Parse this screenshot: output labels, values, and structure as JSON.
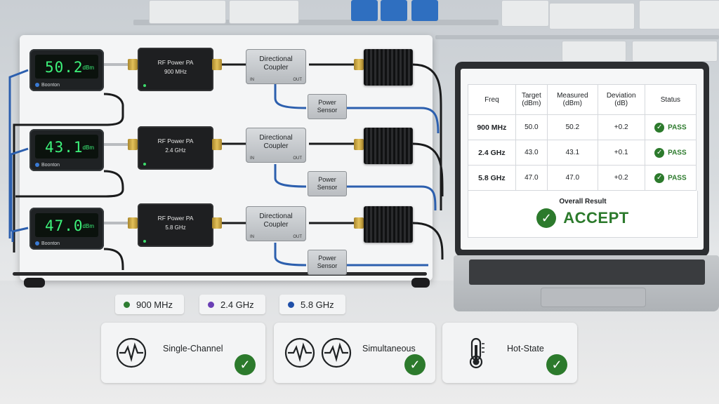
{
  "channels": [
    {
      "meter_value": "50.2",
      "meter_unit": "dBm",
      "meter_brand": "Boonton",
      "amp_title": "RF Power PA",
      "amp_freq": "900 MHz",
      "coupler": [
        "Directional",
        "Coupler"
      ],
      "sensor": [
        "Power",
        "Sensor"
      ]
    },
    {
      "meter_value": "43.1",
      "meter_unit": "dBm",
      "meter_brand": "Boonton",
      "amp_title": "RF Power PA",
      "amp_freq": "2.4 GHz",
      "coupler": [
        "Directional",
        "Coupler"
      ],
      "sensor": [
        "Power",
        "Sensor"
      ]
    },
    {
      "meter_value": "47.0",
      "meter_unit": "dBm",
      "meter_brand": "Boonton",
      "amp_title": "RF Power PA",
      "amp_freq": "5.8 GHz",
      "coupler": [
        "Directional",
        "Coupler"
      ],
      "sensor": [
        "Power",
        "Sensor"
      ]
    }
  ],
  "coupler_ports": {
    "in": "IN",
    "out": "OUT"
  },
  "results_table": {
    "headers": [
      "Freq",
      "Target\n(dBm)",
      "Measured\n(dBm)",
      "Deviation\n(dB)",
      "Status"
    ],
    "rows": [
      {
        "freq": "900 MHz",
        "target": "50.0",
        "measured": "50.2",
        "deviation": "+0.2",
        "status": "PASS"
      },
      {
        "freq": "2.4 GHz",
        "target": "43.0",
        "measured": "43.1",
        "deviation": "+0.1",
        "status": "PASS"
      },
      {
        "freq": "5.8 GHz",
        "target": "47.0",
        "measured": "47.0",
        "deviation": "+0.2",
        "status": "PASS"
      }
    ],
    "overall_label": "Overall Result",
    "overall_value": "ACCEPT"
  },
  "legend": [
    {
      "label": "900 MHz",
      "color": "#2e7d32"
    },
    {
      "label": "2.4 GHz",
      "color": "#6a3fb5"
    },
    {
      "label": "5.8 GHz",
      "color": "#1f4fa8"
    }
  ],
  "modes": [
    {
      "label": "Single-Channel",
      "icon": "waveform-icon"
    },
    {
      "label": "Simultaneous",
      "icon": "dual-waveform-icon"
    },
    {
      "label": "Hot-State",
      "icon": "thermometer-icon"
    }
  ],
  "colors": {
    "pass_green": "#2c7a2c",
    "meter_green": "#3df27a",
    "cable_blue": "#2c5fae"
  }
}
